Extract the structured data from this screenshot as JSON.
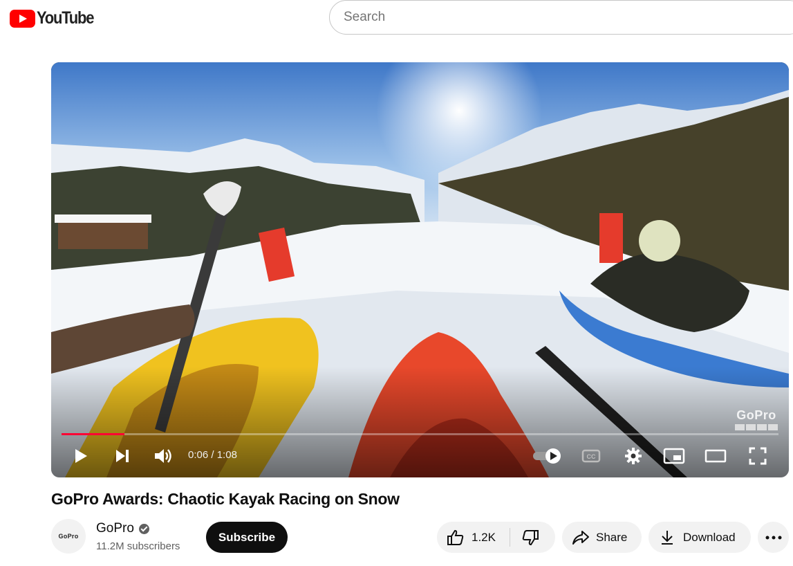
{
  "header": {
    "logo_text": "YouTube",
    "search_placeholder": "Search"
  },
  "player": {
    "current_time": "0:06",
    "duration": "1:08",
    "time_display": "0:06 / 1:08",
    "progress_fraction": 0.088,
    "watermark": "GoPro",
    "autoplay_on": true
  },
  "video": {
    "title": "GoPro Awards: Chaotic Kayak Racing on Snow"
  },
  "channel": {
    "name": "GoPro",
    "subscribers": "11.2M subscribers",
    "avatar_text": "GoPro",
    "verified": true
  },
  "actions": {
    "subscribe_label": "Subscribe",
    "like_count": "1.2K",
    "share_label": "Share",
    "download_label": "Download"
  },
  "colors": {
    "brand_red": "#ff0000",
    "progress_red": "#ff0033",
    "button_dark": "#0f0f0f",
    "pill_bg": "#f2f2f2",
    "secondary_text": "#606060"
  }
}
